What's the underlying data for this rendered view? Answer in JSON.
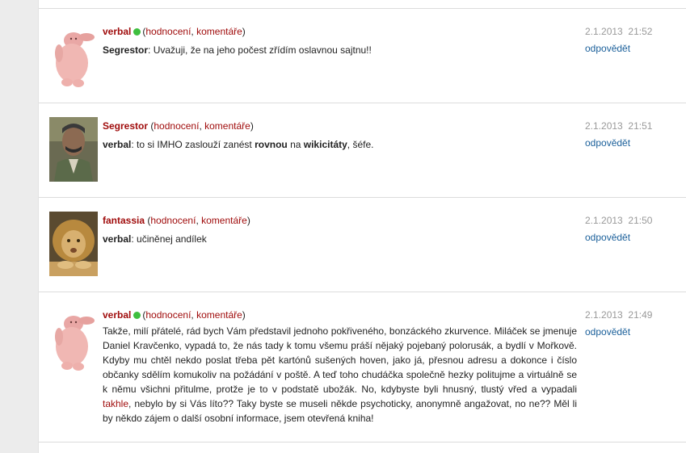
{
  "comments": [
    {
      "author": "verbal",
      "online": true,
      "avatar_icon": "fat-baby-avatar",
      "rating_label": "hodnocení",
      "comments_label": "komentáře",
      "text_parts": {
        "bold_name": "Segrestor",
        "rest": ": Uvažuji, že na jeho počest zřídím oslavnou sajtnu!!"
      },
      "date": "2.1.2013",
      "time": "21:52",
      "reply_label": "odpovědět"
    },
    {
      "author": "Segrestor",
      "online": false,
      "avatar_icon": "man-portrait-avatar",
      "rating_label": "hodnocení",
      "comments_label": "komentáře",
      "text_parts": {
        "bold_name": "verbal",
        "p1": ": to si IMHO zaslouží zanést ",
        "b1": "rovnou",
        "p2": " na ",
        "b2": "wikicitáty",
        "p3": ", šéfe."
      },
      "date": "2.1.2013",
      "time": "21:51",
      "reply_label": "odpovědět"
    },
    {
      "author": "fantassia",
      "online": false,
      "avatar_icon": "lion-avatar",
      "rating_label": "hodnocení",
      "comments_label": "komentáře",
      "text_parts": {
        "bold_name": "verbal",
        "rest": ": učiněnej andílek"
      },
      "date": "2.1.2013",
      "time": "21:50",
      "reply_label": "odpovědět"
    },
    {
      "author": "verbal",
      "online": true,
      "avatar_icon": "fat-baby-avatar",
      "rating_label": "hodnocení",
      "comments_label": "komentáře",
      "text_parts": {
        "p1": "Takže, milí přátelé, rád bych Vám představil jednoho pokřiveného, bonzáckého zkurvence. Miláček se jmenuje Daniel Kravčenko, vypadá to, že nás tady k tomu všemu práší nějaký pojebaný polorusák, a bydlí v Mořkově. Kdyby mu chtěl nekdo poslat třeba pět kartónů sušených hoven, jako já, přesnou adresu a dokonce i číslo občanky sdělím komukoliv na požádání v poště. A teď toho chudáčka společně hezky politujme a virtuálně se k němu všichni přitulme, protže je to v podstatě ubožák. No, kdybyste byli hnusný, tlustý vřed a vypadali ",
        "link": "takhle",
        "p2": ", nebylo by si Vás líto?? Taky byste se museli někde psychoticky, anonymně angažovat, no ne?? Měl li by někdo zájem o další osobní informace, jsem otevřená kniha!"
      },
      "date": "2.1.2013",
      "time": "21:49",
      "reply_label": "odpovědět"
    }
  ]
}
